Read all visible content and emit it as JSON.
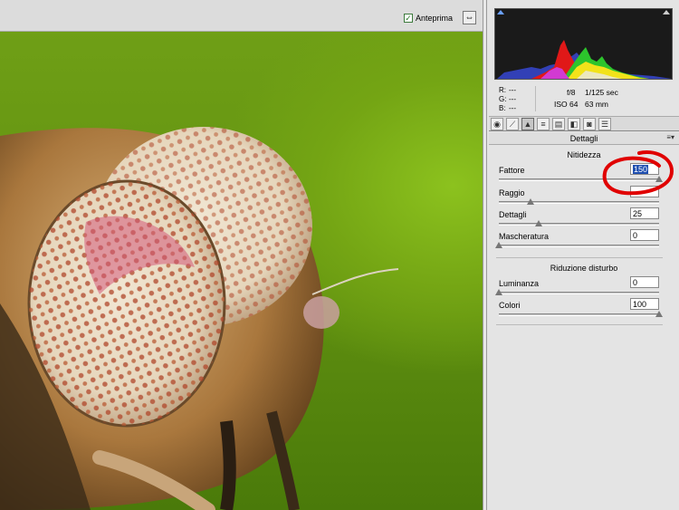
{
  "toolbar": {
    "preview_label": "Anteprima",
    "preview_checked": true,
    "preview_check_glyph": "✓",
    "fullscreen_icon": "⇔"
  },
  "readout": {
    "r_label": "R:",
    "r_value": "---",
    "g_label": "G:",
    "g_value": "---",
    "b_label": "B:",
    "b_value": "---",
    "aperture": "f/8",
    "shutter": "1/125 sec",
    "iso": "ISO 64",
    "focal": "63 mm"
  },
  "tabs": [
    {
      "icon": "aperture-icon",
      "glyph": "◉",
      "active": false
    },
    {
      "icon": "curve-icon",
      "glyph": "⟋",
      "active": false
    },
    {
      "icon": "detail-icon",
      "glyph": "▲",
      "active": true
    },
    {
      "icon": "hsl-icon",
      "glyph": "≡",
      "active": false
    },
    {
      "icon": "split-toning-icon",
      "glyph": "▤",
      "active": false
    },
    {
      "icon": "lens-icon",
      "glyph": "◧",
      "active": false
    },
    {
      "icon": "camera-icon",
      "glyph": "◙",
      "active": false
    },
    {
      "icon": "presets-icon",
      "glyph": "☰",
      "active": false
    }
  ],
  "panel": {
    "title": "Dettagli",
    "menu_glyph": "≡▾",
    "sharpening": {
      "title": "Nitidezza",
      "fattore_label": "Fattore",
      "fattore_value": "150",
      "fattore_level": 1.0,
      "raggio_label": "Raggio",
      "raggio_level": 0.2,
      "dettagli_label": "Dettagli",
      "dettagli_value": "25",
      "dettagli_level": 0.25,
      "mascheratura_label": "Mascheratura",
      "mascheratura_value": "0",
      "mascheratura_level": 0.0
    },
    "noise": {
      "title": "Riduzione disturbo",
      "luminanza_label": "Luminanza",
      "luminanza_value": "0",
      "luminanza_level": 0.0,
      "colori_label": "Colori",
      "colori_value": "100",
      "colori_level": 1.0
    }
  },
  "colors": {
    "annotation_red": "#e00000",
    "selection_blue": "#1f4fb0"
  }
}
